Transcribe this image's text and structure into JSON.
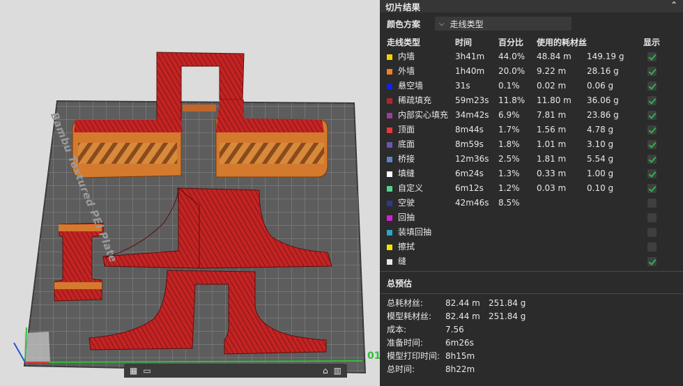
{
  "viewport": {
    "plate_label": "Bambu Textured PEI Plate",
    "axis_number": "01",
    "plate_tab_icons": [
      "grid-icon",
      "lock-icon",
      "trash-icon"
    ]
  },
  "panel": {
    "title": "切片结果",
    "color_scheme_label": "颜色方案",
    "color_scheme_value": "走线类型",
    "columns": [
      "走线类型",
      "时间",
      "百分比",
      "使用的耗材丝",
      "",
      "显示"
    ],
    "rows": [
      {
        "name": "内墙",
        "color": "#f6d300",
        "time": "3h41m",
        "percent": "44.0%",
        "length": "48.84 m",
        "weight": "149.19 g",
        "show": true
      },
      {
        "name": "外墙",
        "color": "#f07f2b",
        "time": "1h40m",
        "percent": "20.0%",
        "length": "9.22 m",
        "weight": "28.16 g",
        "show": true
      },
      {
        "name": "悬空墙",
        "color": "#1320f2",
        "time": "31s",
        "percent": "0.1%",
        "length": "0.02 m",
        "weight": "0.06 g",
        "show": true
      },
      {
        "name": "稀疏填充",
        "color": "#b3252b",
        "time": "59m23s",
        "percent": "11.8%",
        "length": "11.80 m",
        "weight": "36.06 g",
        "show": true
      },
      {
        "name": "内部实心填充",
        "color": "#9c3c9e",
        "time": "34m42s",
        "percent": "6.9%",
        "length": "7.81 m",
        "weight": "23.86 g",
        "show": true
      },
      {
        "name": "顶面",
        "color": "#e8373d",
        "time": "8m44s",
        "percent": "1.7%",
        "length": "1.56 m",
        "weight": "4.78 g",
        "show": true
      },
      {
        "name": "底面",
        "color": "#6a56b3",
        "time": "8m59s",
        "percent": "1.8%",
        "length": "1.01 m",
        "weight": "3.10 g",
        "show": true
      },
      {
        "name": "桥接",
        "color": "#5b84c4",
        "time": "12m36s",
        "percent": "2.5%",
        "length": "1.81 m",
        "weight": "5.54 g",
        "show": true
      },
      {
        "name": "填缝",
        "color": "#ffffff",
        "time": "6m24s",
        "percent": "1.3%",
        "length": "0.33 m",
        "weight": "1.00 g",
        "show": true
      },
      {
        "name": "自定义",
        "color": "#4fd48e",
        "time": "6m12s",
        "percent": "1.2%",
        "length": "0.03 m",
        "weight": "0.10 g",
        "show": true
      },
      {
        "name": "空驶",
        "color": "#2b3a8f",
        "time": "42m46s",
        "percent": "8.5%",
        "length": "",
        "weight": "",
        "show": false
      },
      {
        "name": "回抽",
        "color": "#d21fd8",
        "time": "",
        "percent": "",
        "length": "",
        "weight": "",
        "show": false
      },
      {
        "name": "装填回抽",
        "color": "#2aa6c9",
        "time": "",
        "percent": "",
        "length": "",
        "weight": "",
        "show": false
      },
      {
        "name": "擦拭",
        "color": "#f2e300",
        "time": "",
        "percent": "",
        "length": "",
        "weight": "",
        "show": false
      },
      {
        "name": "缝",
        "color": "#e8e8e8",
        "time": "",
        "percent": "",
        "length": "",
        "weight": "",
        "show": true
      }
    ],
    "summary": {
      "title": "总预估",
      "items": [
        {
          "key": "总耗材丝:",
          "v1": "82.44 m",
          "v2": "251.84 g"
        },
        {
          "key": "模型耗材丝:",
          "v1": "82.44 m",
          "v2": "251.84 g"
        },
        {
          "key": "成本:",
          "v1": "7.56",
          "v2": ""
        },
        {
          "key": "准备时间:",
          "v1": "6m26s",
          "v2": ""
        },
        {
          "key": "模型打印时间:",
          "v1": "8h15m",
          "v2": ""
        },
        {
          "key": "总时间:",
          "v1": "8h22m",
          "v2": ""
        }
      ]
    },
    "colors": {
      "panel_bg": "#2b2b2b",
      "check_green": "#2db34a"
    }
  }
}
